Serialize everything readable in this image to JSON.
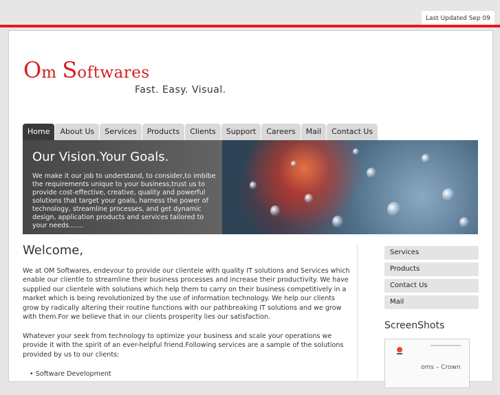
{
  "top": {
    "last_updated": "Last Updated Sep 09"
  },
  "logo": {
    "cap1": "O",
    "rest1": "m ",
    "cap2": "S",
    "rest2": "oftwares"
  },
  "tagline": "Fast. Easy. Visual.",
  "nav": [
    "Home",
    "About Us",
    "Services",
    "Products",
    "Clients",
    "Support",
    "Careers",
    "Mail",
    "Contact Us"
  ],
  "hero": {
    "title": "Our Vision.Your Goals.",
    "text": "We make it our job to understand, to consider,to imbibe the requirements unique to your business,trust us to provide cost-effective, creative, quality and powerful solutions that target your goals, harness the power of technology, streamline processes, and get dynamic design, application products and services tailored to your needs......."
  },
  "main": {
    "welcome": "Welcome,",
    "para1": "We at OM Softwares, endevour to provide our clientele with quality IT solutions and Services which enable our clientle to streamline their business processes and increase their productivity. We have supplied our clientele with solutions which help them to carry on their business competitively in a market which is being revolutionized by the use of information technology. We help our clients grow by radically altering their routine functions with our pathbreaking IT solutions and we grow with them.For we believe that in our clients prosperity lies our satisfaction.",
    "para2": "Whatever your seek from technology to optimize your business and scale your operations we provide it with the spirit of an ever-helpful friend.Following services are a sample of the solutions provided by us to our clients:",
    "list_first": "Software Development"
  },
  "sidebar": {
    "items": [
      "Services",
      "Products",
      "Contact Us",
      "Mail"
    ],
    "screenshots_title": "ScreenShots",
    "screenshot_caption": "oms – Crown"
  },
  "colors": {
    "accent": "#e31b1b",
    "logo": "#d51f1f",
    "nav_active": "#3a3a3a"
  }
}
